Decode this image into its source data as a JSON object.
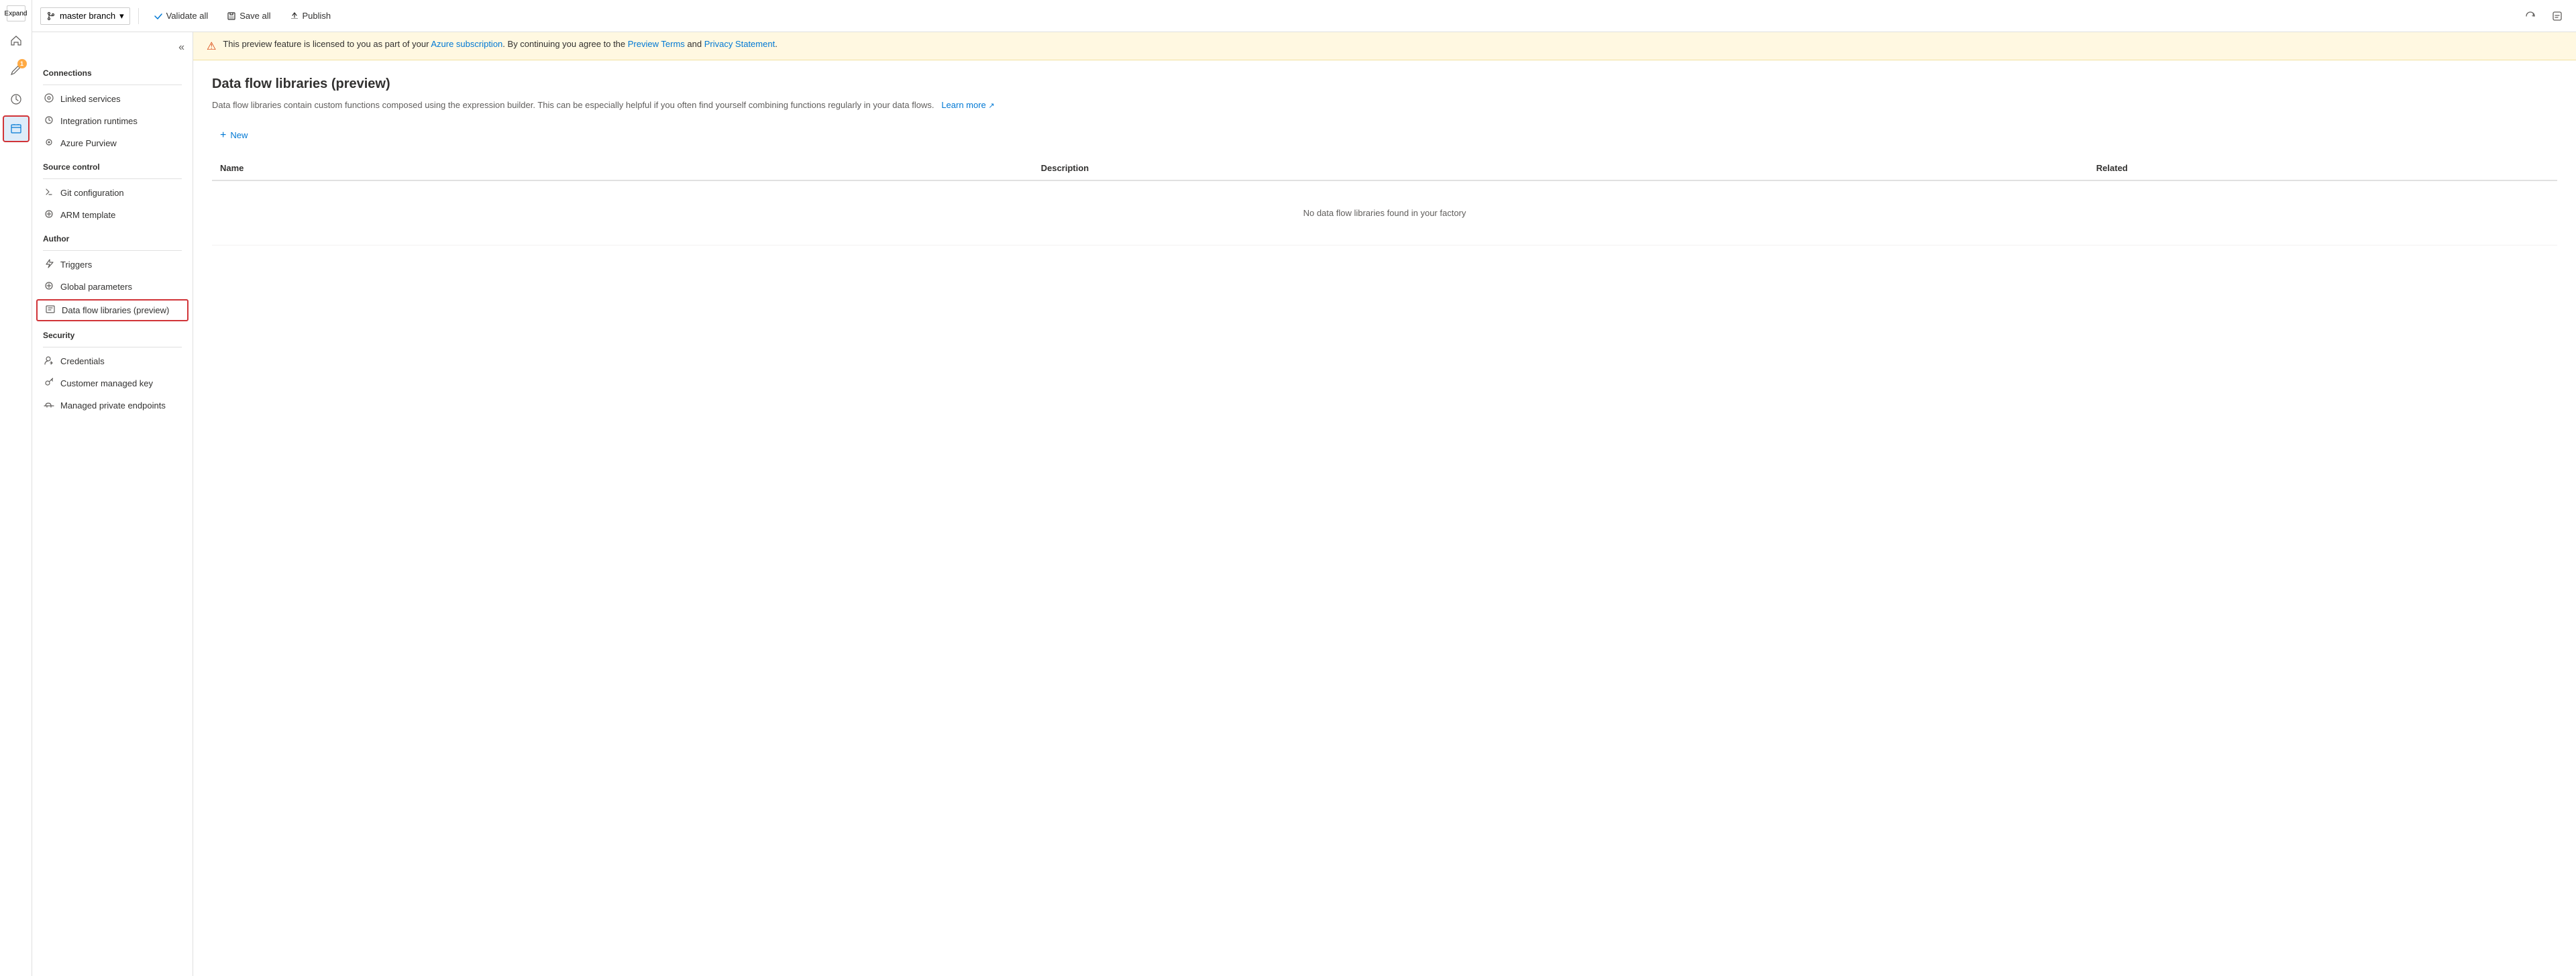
{
  "toolbar": {
    "expand_label": "Expand",
    "branch_name": "master branch",
    "validate_all_label": "Validate all",
    "save_all_label": "Save all",
    "publish_label": "Publish"
  },
  "warning": {
    "text_before": "This preview feature is licensed to you as part of your ",
    "azure_link_text": "Azure subscription",
    "text_middle": ". By continuing you agree to the ",
    "preview_terms_text": "Preview Terms",
    "text_and": " and ",
    "privacy_text": "Privacy Statement",
    "text_end": "."
  },
  "page": {
    "title": "Data flow libraries (preview)",
    "description": "Data flow libraries contain custom functions composed using the expression builder. This can be especially helpful if you often find yourself combining functions regularly in your data flows.",
    "learn_more": "Learn more",
    "new_button_label": "New",
    "table": {
      "col_name": "Name",
      "col_description": "Description",
      "col_related": "Related",
      "empty_message": "No data flow libraries found in your factory"
    }
  },
  "sidebar": {
    "connections_header": "Connections",
    "connections_items": [
      {
        "id": "linked-services",
        "label": "Linked services",
        "icon": "⬡"
      },
      {
        "id": "integration-runtimes",
        "label": "Integration runtimes",
        "icon": "⊕"
      },
      {
        "id": "azure-purview",
        "label": "Azure Purview",
        "icon": "👁"
      }
    ],
    "source_control_header": "Source control",
    "source_control_items": [
      {
        "id": "git-configuration",
        "label": "Git configuration",
        "icon": "◆"
      },
      {
        "id": "arm-template",
        "label": "ARM template",
        "icon": "⊙"
      }
    ],
    "author_header": "Author",
    "author_items": [
      {
        "id": "triggers",
        "label": "Triggers",
        "icon": "⚡"
      },
      {
        "id": "global-parameters",
        "label": "Global parameters",
        "icon": "⊙"
      },
      {
        "id": "data-flow-libraries",
        "label": "Data flow libraries (preview)",
        "icon": "▦",
        "active": true
      }
    ],
    "security_header": "Security",
    "security_items": [
      {
        "id": "credentials",
        "label": "Credentials",
        "icon": "👤"
      },
      {
        "id": "customer-managed-key",
        "label": "Customer managed key",
        "icon": "⊕"
      },
      {
        "id": "managed-private-endpoints",
        "label": "Managed private endpoints",
        "icon": "☁"
      }
    ]
  },
  "rail": {
    "icons": [
      {
        "id": "home",
        "symbol": "⌂",
        "active": false
      },
      {
        "id": "edit",
        "symbol": "✎",
        "badge": "1",
        "active": false
      },
      {
        "id": "monitor",
        "symbol": "◑",
        "active": false
      },
      {
        "id": "manage",
        "symbol": "🧳",
        "active": true
      }
    ]
  }
}
